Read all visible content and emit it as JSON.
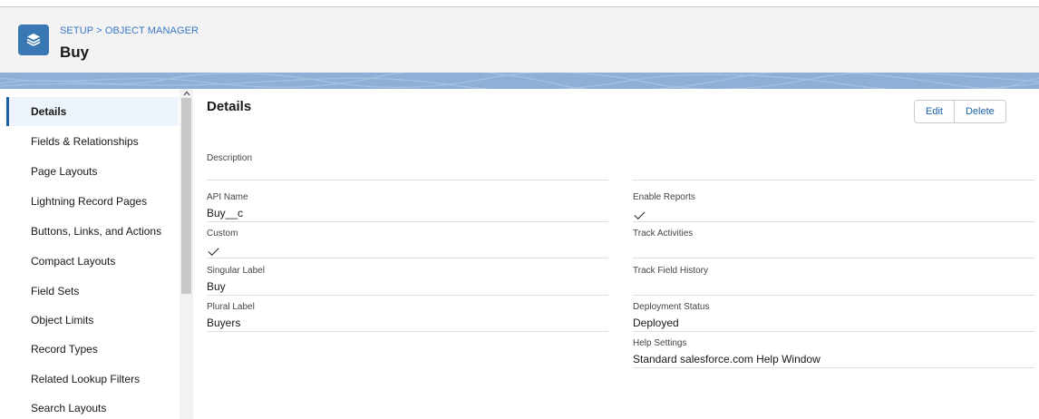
{
  "header": {
    "breadcrumb_setup": "SETUP",
    "breadcrumb_sep": ">",
    "breadcrumb_object_manager": "OBJECT MANAGER",
    "title": "Buy",
    "icon": "layers-icon",
    "icon_bg": "#3a78b4"
  },
  "sidebar": {
    "active_index": 0,
    "items": [
      {
        "label": "Details"
      },
      {
        "label": "Fields & Relationships"
      },
      {
        "label": "Page Layouts"
      },
      {
        "label": "Lightning Record Pages"
      },
      {
        "label": "Buttons, Links, and Actions"
      },
      {
        "label": "Compact Layouts"
      },
      {
        "label": "Field Sets"
      },
      {
        "label": "Object Limits"
      },
      {
        "label": "Record Types"
      },
      {
        "label": "Related Lookup Filters"
      },
      {
        "label": "Search Layouts"
      }
    ]
  },
  "details": {
    "title": "Details",
    "edit_label": "Edit",
    "delete_label": "Delete",
    "left": {
      "description_label": "Description",
      "description_value": "",
      "api_name_label": "API Name",
      "api_name_value": "Buy__c",
      "custom_label": "Custom",
      "custom_checked": true,
      "singular_label_label": "Singular Label",
      "singular_label_value": "Buy",
      "plural_label_label": "Plural Label",
      "plural_label_value": "Buyers"
    },
    "right": {
      "enable_reports_label": "Enable Reports",
      "enable_reports_checked": true,
      "track_activities_label": "Track Activities",
      "track_activities_checked": false,
      "track_field_history_label": "Track Field History",
      "track_field_history_checked": false,
      "deployment_status_label": "Deployment Status",
      "deployment_status_value": "Deployed",
      "help_settings_label": "Help Settings",
      "help_settings_value": "Standard salesforce.com Help Window"
    }
  },
  "colors": {
    "accent": "#1b5fa6",
    "link": "#3b78c6",
    "active_bg": "#eef4fb",
    "band": "#8fb0d6"
  }
}
